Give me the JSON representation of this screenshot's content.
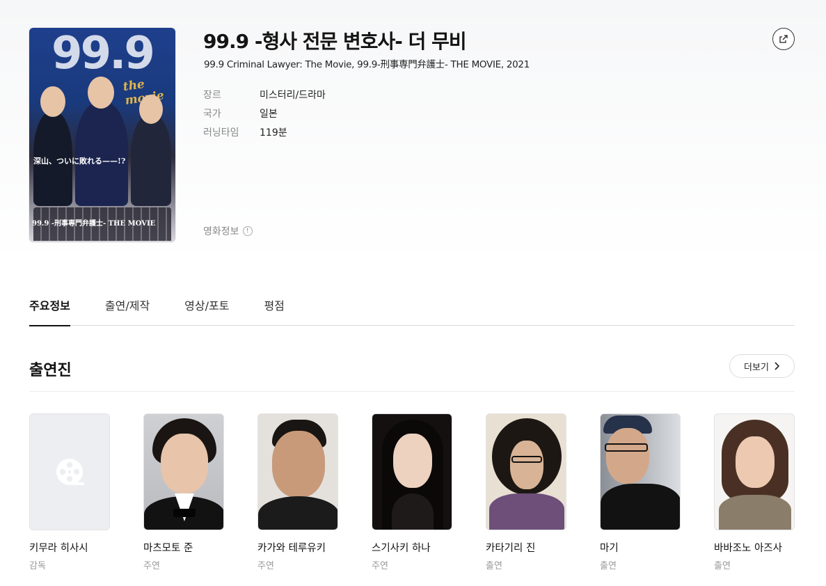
{
  "movie": {
    "title": "99.9 -형사 전문 변호사- 더 무비",
    "subtitle": "99.9 Criminal Lawyer: The Movie, 99.9-刑事専門弁護士- THE MOVIE, 2021",
    "poster": {
      "big_number": "99.9",
      "tagline": "the movie",
      "caption": "深山、ついに敗れる——!?",
      "footer": "99.9 -刑事専門弁護士- THE MOVIE"
    },
    "info": [
      {
        "label": "장르",
        "value": "미스터리/드라마"
      },
      {
        "label": "국가",
        "value": "일본"
      },
      {
        "label": "러닝타임",
        "value": "119분"
      }
    ],
    "movie_info_link": "영화정보",
    "icons": {
      "share": "share-icon",
      "expand": "expand-icon",
      "info": "info-icon"
    }
  },
  "tabs": [
    {
      "label": "주요정보",
      "active": true
    },
    {
      "label": "출연/제작",
      "active": false
    },
    {
      "label": "영상/포토",
      "active": false
    },
    {
      "label": "평점",
      "active": false
    }
  ],
  "cast_section": {
    "title": "출연진",
    "more_label": "더보기",
    "members": [
      {
        "name": "키무라 히사시",
        "role": "감독"
      },
      {
        "name": "마츠모토 준",
        "role": "주연"
      },
      {
        "name": "카가와 테루유키",
        "role": "주연"
      },
      {
        "name": "스기사키 하나",
        "role": "주연"
      },
      {
        "name": "카타기리 진",
        "role": "출연"
      },
      {
        "name": "마기",
        "role": "출연"
      },
      {
        "name": "바바조노 아즈사",
        "role": "출연"
      }
    ]
  }
}
